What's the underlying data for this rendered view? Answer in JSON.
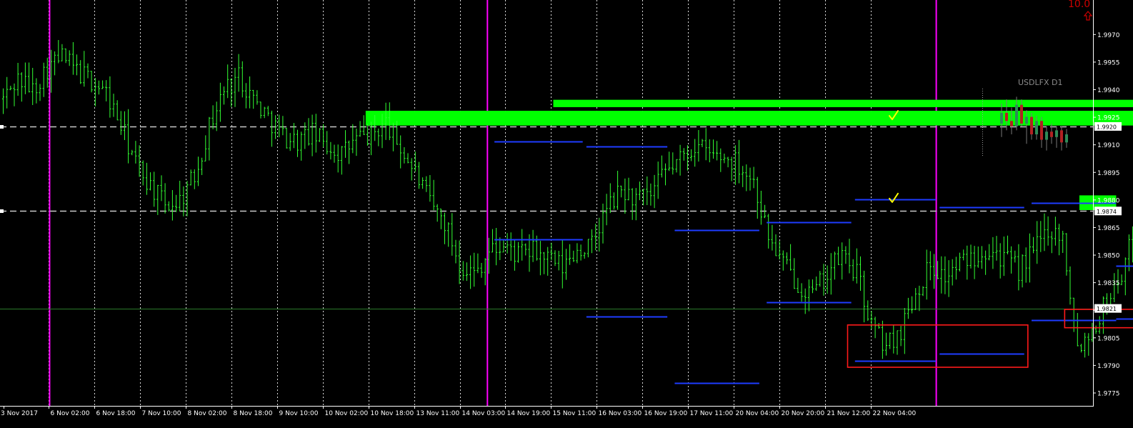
{
  "chart_data": {
    "type": "line",
    "symbol": "USDLFX D1",
    "corner_value": "10.0",
    "ylim": [
      1.9768,
      1.9988
    ],
    "y_ticks": [
      "1.9970",
      "1.9955",
      "1.9940",
      "1.9925",
      "1.9910",
      "1.9895",
      "1.9880",
      "1.9865",
      "1.9850",
      "1.9835",
      "1.9820",
      "1.9805",
      "1.9790",
      "1.9775"
    ],
    "price_tags": [
      "1.9920",
      "1.9874",
      "1.9821"
    ],
    "x_labels": [
      "3 Nov 2017",
      "6 Nov 02:00",
      "6 Nov 18:00",
      "7 Nov 10:00",
      "8 Nov 02:00",
      "8 Nov 18:00",
      "9 Nov 10:00",
      "10 Nov 02:00",
      "10 Nov 18:00",
      "13 Nov 11:00",
      "14 Nov 03:00",
      "14 Nov 19:00",
      "15 Nov 11:00",
      "16 Nov 03:00",
      "16 Nov 19:00",
      "17 Nov 11:00",
      "20 Nov 04:00",
      "20 Nov 20:00",
      "21 Nov 12:00",
      "22 Nov 04:00"
    ],
    "n_bars": 368,
    "price_path": [
      [
        0,
        1.9935
      ],
      [
        4,
        1.9946
      ],
      [
        8,
        1.994
      ],
      [
        12,
        1.9952
      ],
      [
        16,
        1.9958
      ],
      [
        20,
        1.995
      ],
      [
        24,
        1.9945
      ],
      [
        28,
        1.9938
      ],
      [
        32,
        1.992
      ],
      [
        36,
        1.99
      ],
      [
        40,
        1.9888
      ],
      [
        44,
        1.9877
      ],
      [
        48,
        1.988
      ],
      [
        52,
        1.9893
      ],
      [
        56,
        1.992
      ],
      [
        60,
        1.994
      ],
      [
        64,
        1.9948
      ],
      [
        68,
        1.9935
      ],
      [
        72,
        1.9925
      ],
      [
        76,
        1.9915
      ],
      [
        80,
        1.9912
      ],
      [
        84,
        1.9916
      ],
      [
        88,
        1.991
      ],
      [
        92,
        1.9905
      ],
      [
        96,
        1.9913
      ],
      [
        100,
        1.9915
      ],
      [
        104,
        1.9922
      ],
      [
        108,
        1.9908
      ],
      [
        112,
        1.9895
      ],
      [
        116,
        1.9878
      ],
      [
        120,
        1.9868
      ],
      [
        124,
        1.9846
      ],
      [
        128,
        1.984
      ],
      [
        132,
        1.9852
      ],
      [
        136,
        1.9855
      ],
      [
        140,
        1.985
      ],
      [
        144,
        1.9852
      ],
      [
        148,
        1.9848
      ],
      [
        152,
        1.9843
      ],
      [
        156,
        1.9853
      ],
      [
        160,
        1.9855
      ],
      [
        164,
        1.9875
      ],
      [
        168,
        1.9885
      ],
      [
        172,
        1.988
      ],
      [
        176,
        1.9882
      ],
      [
        180,
        1.9895
      ],
      [
        184,
        1.9902
      ],
      [
        188,
        1.991
      ],
      [
        192,
        1.9905
      ],
      [
        196,
        1.9903
      ],
      [
        200,
        1.99
      ],
      [
        204,
        1.989
      ],
      [
        208,
        1.986
      ],
      [
        212,
        1.9845
      ],
      [
        216,
        1.9835
      ],
      [
        220,
        1.9828
      ],
      [
        224,
        1.984
      ],
      [
        228,
        1.985
      ],
      [
        232,
        1.984
      ],
      [
        236,
        1.9812
      ],
      [
        240,
        1.98
      ],
      [
        244,
        1.981
      ],
      [
        248,
        1.983
      ],
      [
        252,
        1.9845
      ],
      [
        256,
        1.9838
      ],
      [
        260,
        1.9845
      ],
      [
        264,
        1.985
      ],
      [
        268,
        1.9855
      ],
      [
        272,
        1.9848
      ],
      [
        276,
        1.9842
      ],
      [
        280,
        1.9852
      ],
      [
        284,
        1.9865
      ],
      [
        288,
        1.986
      ],
      [
        292,
        1.98
      ],
      [
        296,
        1.981
      ],
      [
        300,
        1.9825
      ],
      [
        304,
        1.984
      ],
      [
        308,
        1.9865
      ],
      [
        312,
        1.982
      ],
      [
        316,
        1.9825
      ],
      [
        320,
        1.9842
      ],
      [
        324,
        1.9838
      ],
      [
        328,
        1.984
      ],
      [
        332,
        1.9805
      ],
      [
        336,
        1.9818
      ],
      [
        340,
        1.9855
      ],
      [
        344,
        1.9868
      ],
      [
        348,
        1.9878
      ],
      [
        352,
        1.9872
      ],
      [
        356,
        1.9865
      ],
      [
        360,
        1.9855
      ],
      [
        364,
        1.9843
      ],
      [
        368,
        1.983
      ],
      [
        372,
        1.9835
      ],
      [
        376,
        1.9828
      ],
      [
        380,
        1.983
      ],
      [
        384,
        1.9822
      ]
    ],
    "daily_panel": {
      "title": "USDLFX D1",
      "candles": [
        {
          "o": 1.992,
          "h": 1.9935,
          "l": 1.991,
          "c": 1.9928
        },
        {
          "o": 1.9928,
          "h": 1.9938,
          "l": 1.9915,
          "c": 1.9922
        },
        {
          "o": 1.9922,
          "h": 1.9932,
          "l": 1.9912,
          "c": 1.9918
        },
        {
          "o": 1.9918,
          "h": 1.994,
          "l": 1.9915,
          "c": 1.9934
        },
        {
          "o": 1.9934,
          "h": 1.9938,
          "l": 1.9918,
          "c": 1.992
        },
        {
          "o": 1.992,
          "h": 1.993,
          "l": 1.9905,
          "c": 1.9925
        },
        {
          "o": 1.9925,
          "h": 1.9928,
          "l": 1.9908,
          "c": 1.9912
        },
        {
          "o": 1.9912,
          "h": 1.9926,
          "l": 1.9908,
          "c": 1.9922
        },
        {
          "o": 1.9922,
          "h": 1.9925,
          "l": 1.9902,
          "c": 1.9908
        },
        {
          "o": 1.9908,
          "h": 1.9918,
          "l": 1.99,
          "c": 1.9914
        },
        {
          "o": 1.9914,
          "h": 1.992,
          "l": 1.9905,
          "c": 1.991
        },
        {
          "o": 1.991,
          "h": 1.9918,
          "l": 1.9902,
          "c": 1.9915
        },
        {
          "o": 1.9915,
          "h": 1.9918,
          "l": 1.99,
          "c": 1.9906
        },
        {
          "o": 1.9906,
          "h": 1.9916,
          "l": 1.9902,
          "c": 1.9912
        }
      ]
    },
    "horizontal_dashed_levels": [
      1.992,
      1.9874
    ],
    "current_price_line": 1.9821,
    "magenta_day_separators_bar": [
      13,
      132,
      254
    ],
    "supply_zones": [
      {
        "bar_start": 99,
        "bar_end": 313,
        "top": 1.99285,
        "bottom": 1.99205
      },
      {
        "bar_start": 150,
        "bar_end": 313,
        "top": 1.99345,
        "bottom": 1.99305
      },
      {
        "bar_start": 293,
        "bar_end": 303,
        "top": 1.98825,
        "bottom": 1.98745
      }
    ],
    "checkmarks": [
      1.9925,
      1.988
    ],
    "swing_levels": [
      {
        "bar_start": 134,
        "bar_end": 158,
        "y": 1.9912
      },
      {
        "bar_start": 134,
        "bar_end": 158,
        "y": 1.98585
      },
      {
        "bar_start": 159,
        "bar_end": 181,
        "y": 1.9909
      },
      {
        "bar_start": 159,
        "bar_end": 181,
        "y": 1.98165
      },
      {
        "bar_start": 183,
        "bar_end": 206,
        "y": 1.98635
      },
      {
        "bar_start": 183,
        "bar_end": 206,
        "y": 1.97805
      },
      {
        "bar_start": 208,
        "bar_end": 231,
        "y": 1.9868
      },
      {
        "bar_start": 208,
        "bar_end": 231,
        "y": 1.98245
      },
      {
        "bar_start": 232,
        "bar_end": 254,
        "y": 1.98805
      },
      {
        "bar_start": 232,
        "bar_end": 254,
        "y": 1.97925
      },
      {
        "bar_start": 255,
        "bar_end": 278,
        "y": 1.9876
      },
      {
        "bar_start": 255,
        "bar_end": 278,
        "y": 1.97965
      },
      {
        "bar_start": 280,
        "bar_end": 303,
        "y": 1.98785
      },
      {
        "bar_start": 280,
        "bar_end": 303,
        "y": 1.98145
      },
      {
        "bar_start": 303,
        "bar_end": 311,
        "y": 1.9844
      },
      {
        "bar_start": 303,
        "bar_end": 311,
        "y": 1.98155
      }
    ],
    "marked_boxes": [
      {
        "bar_start": 230,
        "bar_end": 279,
        "top": 1.9812,
        "bottom": 1.9789
      },
      {
        "bar_start": 289,
        "bar_end": 320,
        "top": 1.98205,
        "bottom": 1.98105
      }
    ],
    "grid": "vertical dotted",
    "colors": {
      "background": "#000000",
      "price": "#33ff33",
      "grid": "#ffffff",
      "separator": "#ff00ff",
      "zone": "#00ff00",
      "swing": "#1e3cff",
      "box": "#ff1a1a",
      "checkmark": "#ffff00",
      "level": "#c8c8c8",
      "current_line": "#2a7a2a",
      "bull_candle": "#2e8b57",
      "bear_candle": "#b22222"
    }
  }
}
